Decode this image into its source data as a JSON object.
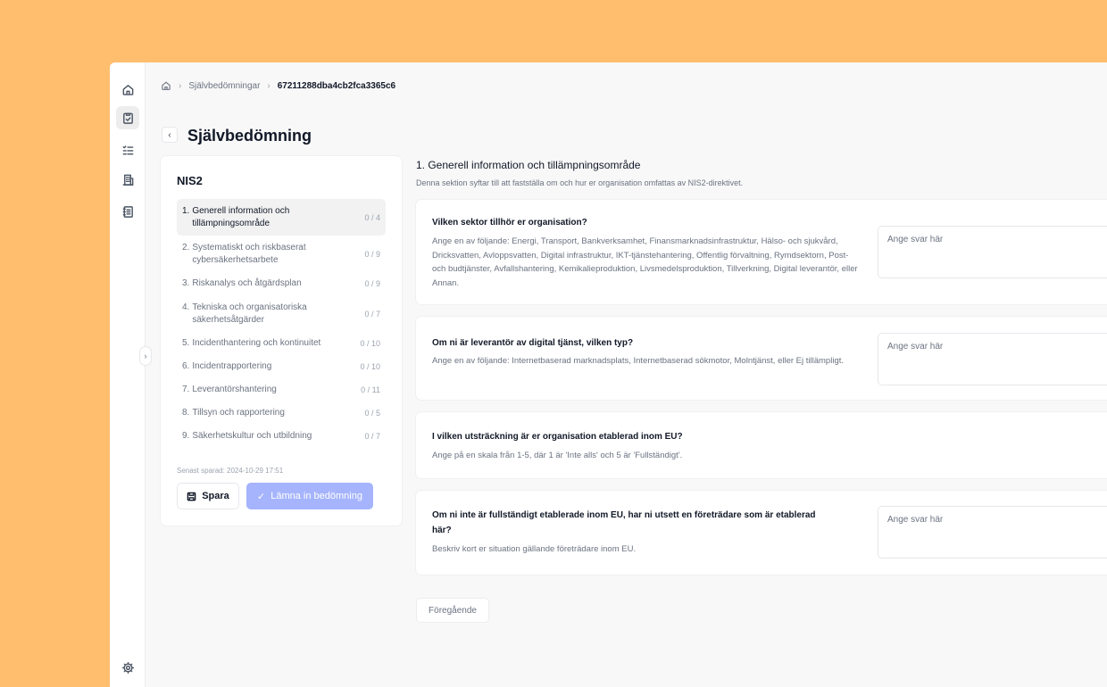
{
  "breadcrumb": {
    "home_icon": "home-icon",
    "items": [
      "Självbedömningar",
      "67211288dba4cb2fca3365c6"
    ]
  },
  "page": {
    "title": "Självbedömning"
  },
  "rail": {
    "icons": [
      "home-icon",
      "clipboard-check-icon",
      "checklist-icon",
      "building-icon",
      "notebook-icon"
    ],
    "settings_icon": "gear-icon"
  },
  "nav": {
    "title": "NIS2",
    "items": [
      {
        "num": "1.",
        "label": "Generell information och tillämpningsområde",
        "count": "0 / 4"
      },
      {
        "num": "2.",
        "label": "Systematiskt och riskbaserat cybersäkerhetsarbete",
        "count": "0 / 9"
      },
      {
        "num": "3.",
        "label": "Riskanalys och åtgärdsplan",
        "count": "0 / 9"
      },
      {
        "num": "4.",
        "label": "Tekniska och organisatoriska säkerhetsåtgärder",
        "count": "0 / 7"
      },
      {
        "num": "5.",
        "label": "Incidenthantering och kontinuitet",
        "count": "0 / 10"
      },
      {
        "num": "6.",
        "label": "Incidentrapportering",
        "count": "0 / 10"
      },
      {
        "num": "7.",
        "label": "Leverantörshantering",
        "count": "0 / 11"
      },
      {
        "num": "8.",
        "label": "Tillsyn och rapportering",
        "count": "0 / 5"
      },
      {
        "num": "9.",
        "label": "Säkerhetskultur och utbildning",
        "count": "0 / 7"
      }
    ],
    "last_saved": "Senast sparad: 2024-10-29 17:51",
    "save_label": "Spara",
    "submit_label": "Lämna in bedömning"
  },
  "section": {
    "title": "1. Generell information och tillämpningsområde",
    "description": "Denna sektion syftar till att fastställa om och hur er organisation omfattas av NIS2-direktivet."
  },
  "questions": [
    {
      "title": "Vilken sektor tillhör er organisation?",
      "help": "Ange en av följande: Energi, Transport, Bankverksamhet, Finansmarknadsinfrastruktur, Hälso- och sjukvård, Dricksvatten, Avloppsvatten, Digital infrastruktur, IKT-tjänstehantering, Offentlig förvaltning, Rymdsektorn, Post- och budtjänster, Avfallshantering, Kemikalieproduktion, Livsmedelsproduktion, Tillverkning, Digital leverantör, eller Annan.",
      "placeholder": "Ange svar här"
    },
    {
      "title": "Om ni är leverantör av digital tjänst, vilken typ?",
      "help": "Ange en av följande: Internetbaserad marknadsplats, Internetbaserad sökmotor, Molntjänst, eller Ej tillämpligt.",
      "placeholder": "Ange svar här"
    },
    {
      "title": "I vilken utsträckning är er organisation etablerad inom EU?",
      "help": "Ange på en skala från 1-5, där 1 är 'Inte alls' och 5 är 'Fullständigt'."
    },
    {
      "title": "Om ni inte är fullständigt etablerade inom EU, har ni utsett en företrädare som är etablerad här?",
      "help": "Beskriv kort er situation gällande företrädare inom EU.",
      "placeholder": "Ange svar här"
    }
  ],
  "footer": {
    "prev_label": "Föregående"
  }
}
